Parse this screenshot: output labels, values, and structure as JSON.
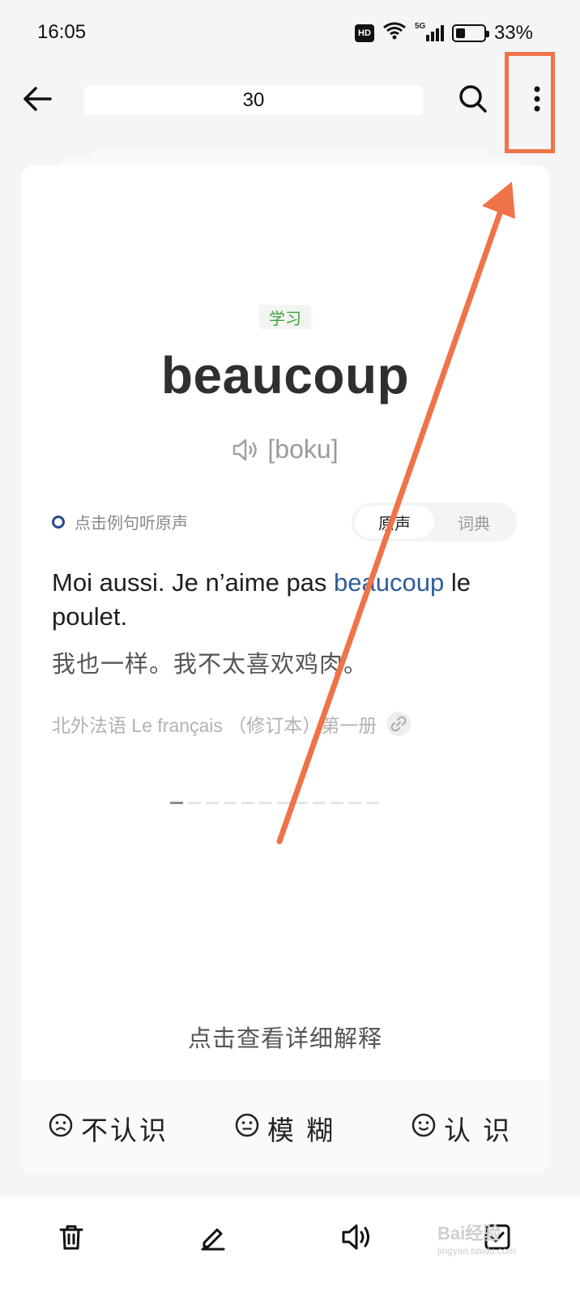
{
  "status_bar": {
    "time": "16:05",
    "hd_label": "HD",
    "network": "5G",
    "battery_percent": 33,
    "battery_text": "33%"
  },
  "header": {
    "back_icon": "arrow-left-icon",
    "title": "30",
    "search_icon": "search-icon",
    "more_icon": "more-vertical-icon"
  },
  "card": {
    "tag": "学习",
    "word": "beaucoup",
    "phonetic": "[boku]",
    "hint": "点击例句听原声",
    "toggle": {
      "options": [
        "原声",
        "词典"
      ],
      "selected": "原声"
    },
    "example": {
      "before": "Moi aussi. Je n’aime pas ",
      "highlight": "beaucoup",
      "after": " le poulet.",
      "translation": "我也一样。我不太喜欢鸡肉。",
      "source": "北外法语 Le français （修订本）第一册"
    },
    "pager": {
      "total": 12,
      "current": 1
    },
    "detail_link": "点击查看详细解释"
  },
  "answers": [
    {
      "label": "不认识",
      "icon": "frown-face-icon"
    },
    {
      "label": "模 糊",
      "icon": "neutral-face-icon"
    },
    {
      "label": "认 识",
      "icon": "smile-face-icon"
    }
  ],
  "toolbar": {
    "icons": [
      "trash-icon",
      "edit-icon",
      "speaker-icon",
      "checkbox-icon"
    ]
  },
  "watermark": {
    "brand": "Bai经验",
    "url": "jingyan.baidu.com"
  },
  "colors": {
    "accent_blue": "#2e5d9b",
    "tag_green": "#3aa53a",
    "annotation": "#f07348",
    "background": "#f4f5f7"
  }
}
